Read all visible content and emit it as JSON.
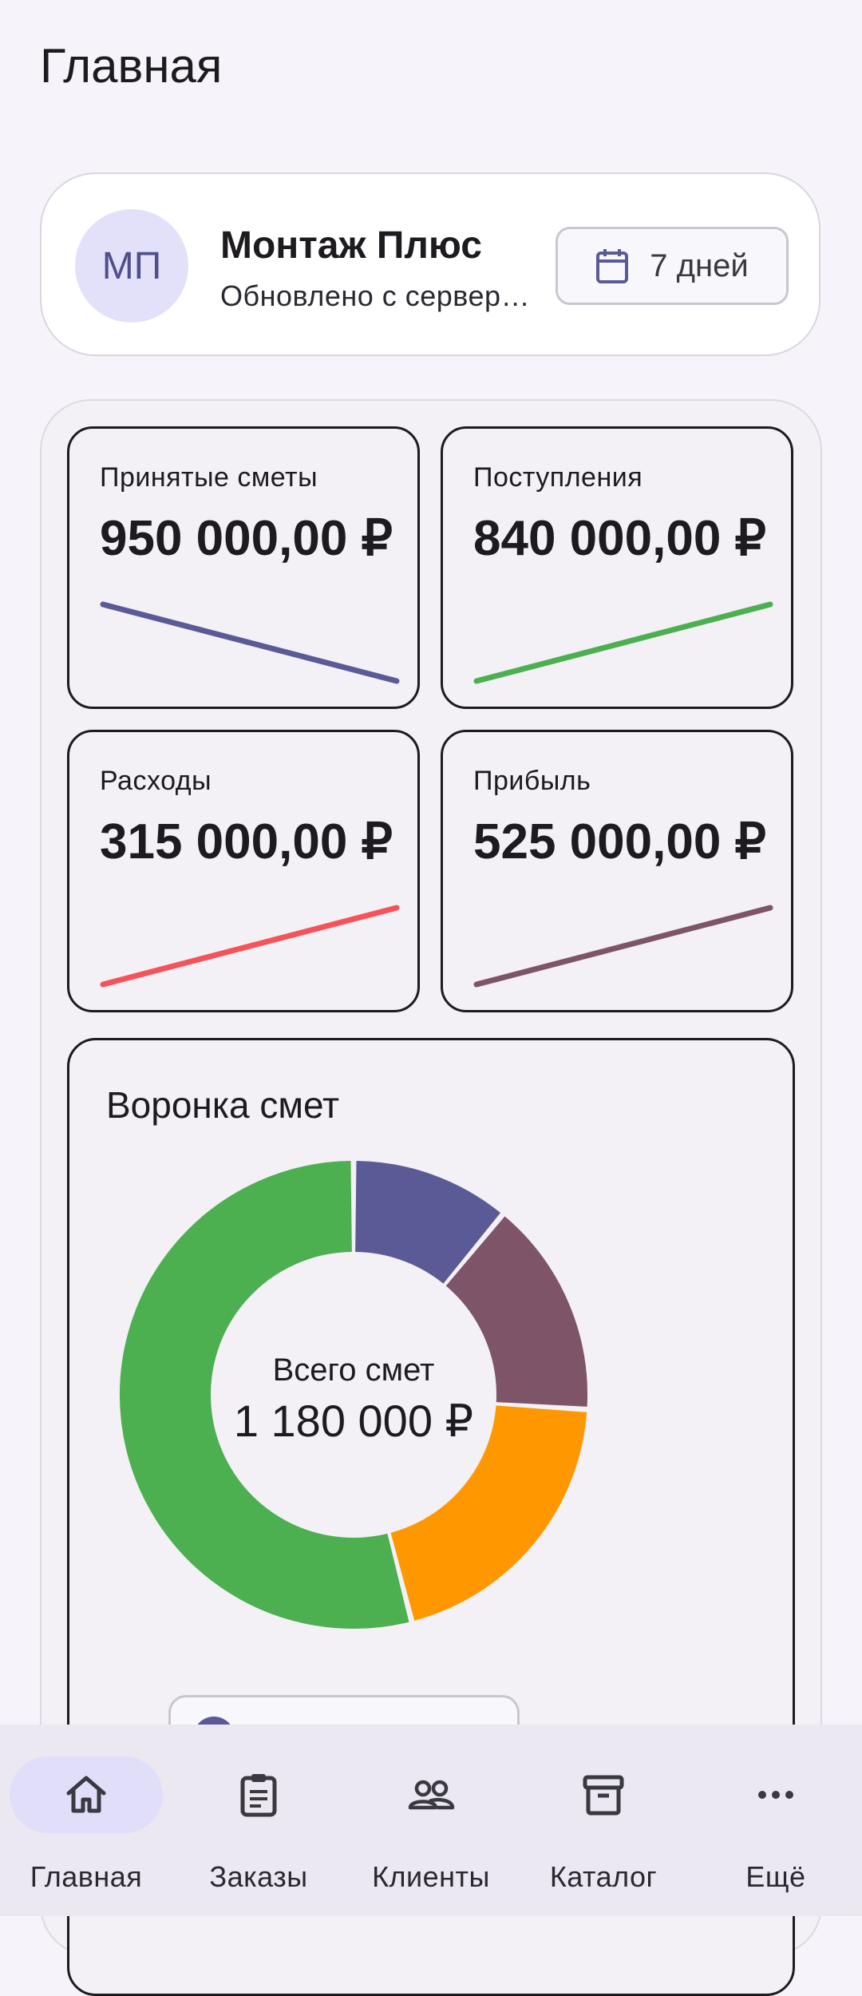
{
  "page": {
    "title": "Главная"
  },
  "header": {
    "avatar_initials": "МП",
    "company_name": "Монтаж Плюс",
    "status": "Обновлено с сервер…",
    "period_label": "7 дней",
    "period_icon": "calendar-icon"
  },
  "kpis": [
    {
      "label": "Принятые сметы",
      "value": "950 000,00 ₽",
      "trend": "down",
      "color": "#5a5a96"
    },
    {
      "label": "Поступления",
      "value": "840 000,00 ₽",
      "trend": "up",
      "color": "#4caf50"
    },
    {
      "label": "Расходы",
      "value": "315 000,00 ₽",
      "trend": "up",
      "color": "#f5535a"
    },
    {
      "label": "Прибыль",
      "value": "525 000,00 ₽",
      "trend": "up",
      "color": "#7d5468"
    }
  ],
  "funnel": {
    "title": "Воронка смет",
    "center_label": "Всего смет",
    "center_value": "1 180 000 ₽"
  },
  "chart_data": {
    "type": "pie",
    "title": "Воронка смет",
    "segments": [
      {
        "value": 0.11,
        "color": "#5a5a96"
      },
      {
        "value": 0.15,
        "color": "#7d5468"
      },
      {
        "value": 0.2,
        "color": "#ff9800"
      },
      {
        "value": 0.54,
        "color": "#4caf50"
      }
    ],
    "total_label": "Всего смет",
    "total_value": "1 180 000 ₽"
  },
  "nav": {
    "items": [
      {
        "label": "Главная",
        "icon": "home-icon",
        "active": true
      },
      {
        "label": "Заказы",
        "icon": "clipboard-icon",
        "active": false
      },
      {
        "label": "Клиенты",
        "icon": "people-icon",
        "active": false
      },
      {
        "label": "Каталог",
        "icon": "archive-icon",
        "active": false
      },
      {
        "label": "Ещё",
        "icon": "more-icon",
        "active": false
      }
    ]
  },
  "colors": {
    "accent": "#5a5a96",
    "background": "#f7f3fa"
  }
}
